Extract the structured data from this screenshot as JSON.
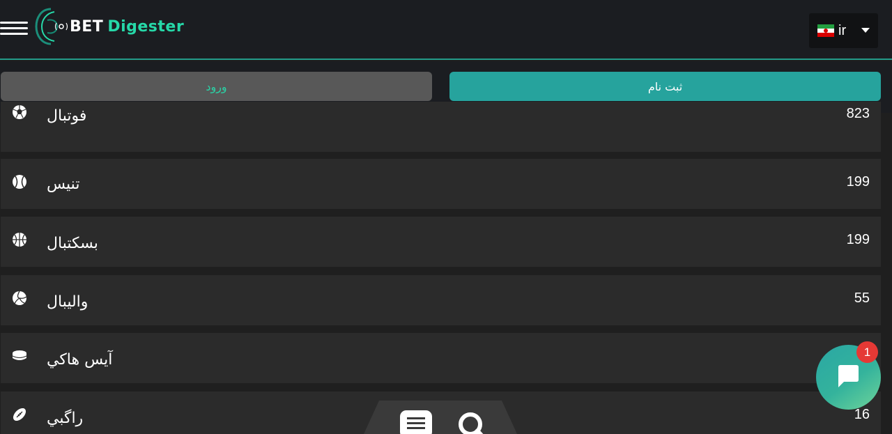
{
  "header": {
    "logo": {
      "brand_bet": "BET",
      "brand_digester": "Digester"
    },
    "language": {
      "code": "ir",
      "flag": "iran-flag-icon"
    }
  },
  "auth": {
    "login_label": "ورود",
    "register_label": "ثبت نام"
  },
  "sports": [
    {
      "name": "فوتبال",
      "count": "823",
      "icon": "soccer-ball-icon"
    },
    {
      "name": "تنیس",
      "count": "199",
      "icon": "tennis-ball-icon"
    },
    {
      "name": "بسکتبال",
      "count": "199",
      "icon": "basketball-icon"
    },
    {
      "name": "والیبال",
      "count": "55",
      "icon": "volleyball-icon"
    },
    {
      "name": "آيس هاكي",
      "count": "",
      "icon": "hockey-puck-icon"
    },
    {
      "name": "راگبي",
      "count": "16",
      "icon": "rugby-ball-icon"
    }
  ],
  "chat": {
    "badge_count": "1"
  },
  "colors": {
    "accent": "#26a39d",
    "accent_text": "#2bd1a5",
    "badge": "#e53935",
    "row_bg": "#2b2b2b"
  }
}
